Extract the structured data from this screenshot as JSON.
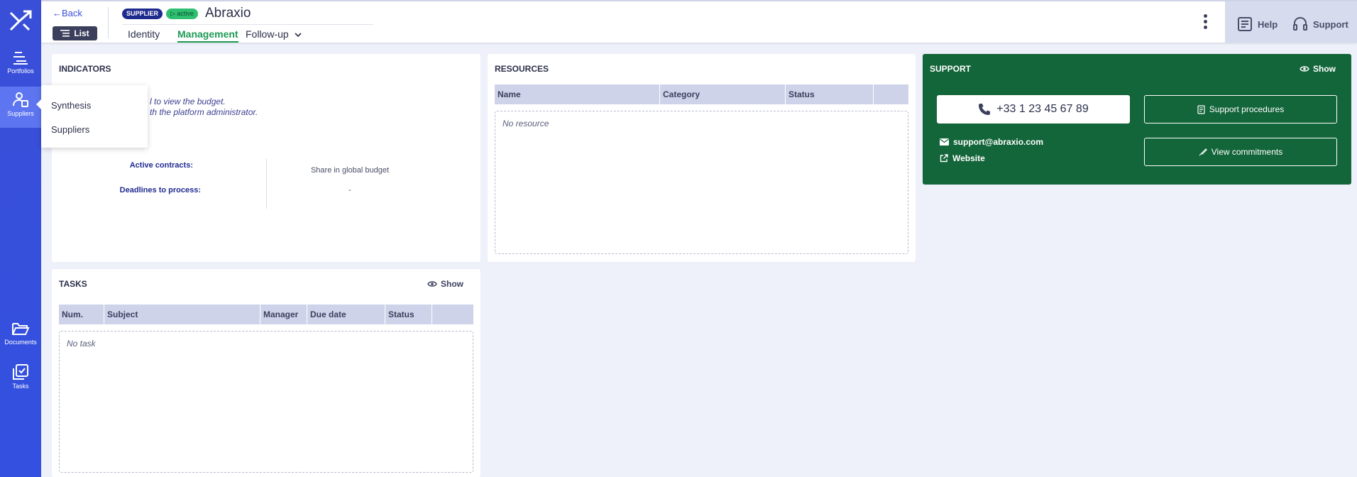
{
  "sidebar": {
    "items": [
      {
        "label": "Portfolios",
        "icon": "portfolios-icon"
      },
      {
        "label": "Suppliers",
        "icon": "suppliers-icon"
      },
      {
        "label": "Documents",
        "icon": "folder-icon"
      },
      {
        "label": "Tasks",
        "icon": "tasks-icon"
      }
    ],
    "flyout": [
      "Synthesis",
      "Suppliers"
    ]
  },
  "header": {
    "back": "Back",
    "list": "List",
    "badge_type": "SUPPLIER",
    "badge_status": "active",
    "title": "Abraxio",
    "tabs": [
      "Identity",
      "Management",
      "Follow-up"
    ],
    "help": "Help",
    "support": "Support"
  },
  "indicators": {
    "title": "INDICATORS",
    "message_line1": "l to view the budget.",
    "message_line2": "th the platform administrator.",
    "active_contracts": "Active contracts:",
    "deadlines": "Deadlines to process:",
    "share": "Share in global budget",
    "share_value": "-"
  },
  "resources": {
    "title": "RESOURCES",
    "columns": [
      "Name",
      "Category",
      "Status"
    ],
    "empty": "No resource"
  },
  "tasks": {
    "title": "TASKS",
    "show": "Show",
    "columns": [
      "Num.",
      "Subject",
      "Manager",
      "Due date",
      "Status"
    ],
    "empty": "No task"
  },
  "support": {
    "title": "SUPPORT",
    "show": "Show",
    "phone": "+33 1 23 45 67 89",
    "procedures": "Support procedures",
    "commitments": "View commitments",
    "email": "support@abraxio.com",
    "website": "Website"
  },
  "colors": {
    "primary": "#3a4fd8",
    "accent_green": "#1d9a55",
    "support_bg": "#13653a"
  }
}
